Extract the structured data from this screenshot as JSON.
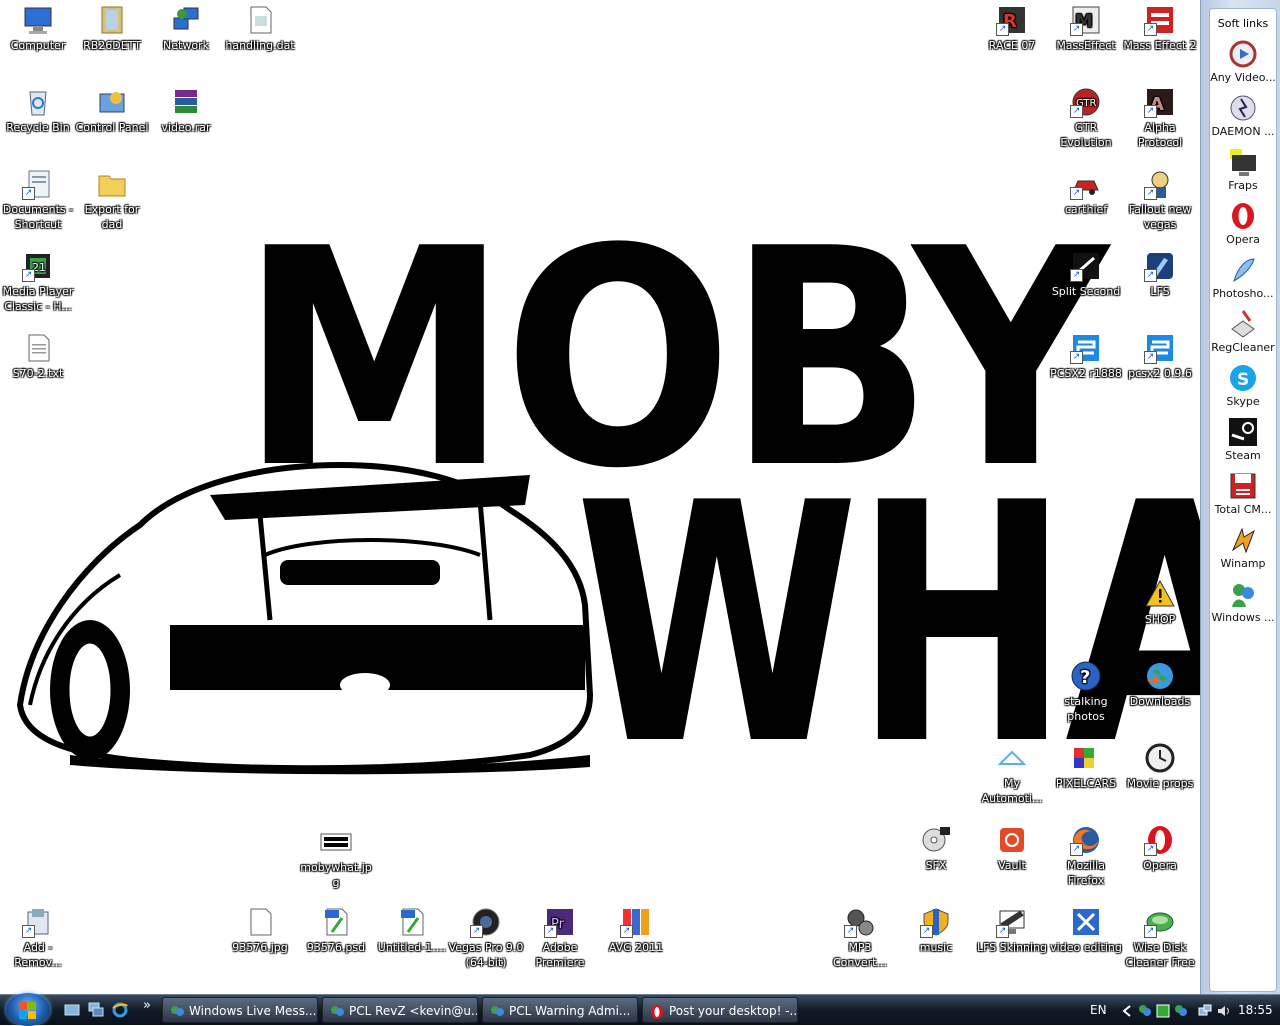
{
  "wallpaper": {
    "line1": "MOBY",
    "line2": "WHAT"
  },
  "desktop_icons": [
    {
      "label": "Computer",
      "icon": "computer-icon"
    },
    {
      "label": "RB26DETT",
      "icon": "folder-icon"
    },
    {
      "label": "Network",
      "icon": "network-icon"
    },
    {
      "label": "handling.dat",
      "icon": "file-icon"
    },
    {
      "label": "Recycle Bin",
      "icon": "recycle-bin-icon"
    },
    {
      "label": "Control Panel",
      "icon": "control-panel-icon"
    },
    {
      "label": "video.rar",
      "icon": "winrar-icon"
    },
    {
      "label": "Documents - Shortcut",
      "icon": "documents-shortcut-icon"
    },
    {
      "label": "Export for dad",
      "icon": "folder-icon"
    },
    {
      "label": "Media Player Classic - H...",
      "icon": "media-player-icon"
    },
    {
      "label": "S70-2.txt",
      "icon": "text-file-icon"
    },
    {
      "label": "RACE 07",
      "icon": "race07-icon"
    },
    {
      "label": "MassEffect",
      "icon": "masseffect-icon"
    },
    {
      "label": "Mass Effect 2",
      "icon": "masseffect2-icon"
    },
    {
      "label": "GTR Evolution",
      "icon": "gtr-evolution-icon"
    },
    {
      "label": "Alpha Protocol",
      "icon": "alpha-protocol-icon"
    },
    {
      "label": "carthief",
      "icon": "carthief-icon"
    },
    {
      "label": "Fallout new vegas",
      "icon": "fallout-icon"
    },
    {
      "label": "Split Second",
      "icon": "split-second-icon"
    },
    {
      "label": "LFS",
      "icon": "lfs-icon"
    },
    {
      "label": "PCSX2 r1888",
      "icon": "pcsx2-icon"
    },
    {
      "label": "pcsx2 0.9.6",
      "icon": "pcsx2-icon"
    },
    {
      "label": "SHOP",
      "icon": "warning-icon"
    },
    {
      "label": "stalking photos",
      "icon": "help-icon"
    },
    {
      "label": "Downloads",
      "icon": "globe-icon"
    },
    {
      "label": "My Automoti...",
      "icon": "triangle-icon"
    },
    {
      "label": "PIXELCARS",
      "icon": "pixelcars-icon"
    },
    {
      "label": "Movie props",
      "icon": "clock-icon"
    },
    {
      "label": "SFX",
      "icon": "sfx-icon"
    },
    {
      "label": "Vault",
      "icon": "vault-icon"
    },
    {
      "label": "Mozilla Firefox",
      "icon": "firefox-icon"
    },
    {
      "label": "Opera",
      "icon": "opera-icon"
    },
    {
      "label": "mobywhat.jpg",
      "icon": "image-icon"
    },
    {
      "label": "Add - Remov...",
      "icon": "add-remove-icon"
    },
    {
      "label": "93576.jpg",
      "icon": "file-icon"
    },
    {
      "label": "93576.psd",
      "icon": "psd-icon"
    },
    {
      "label": "Untitled-1....",
      "icon": "psd-icon"
    },
    {
      "label": "Vegas Pro 9.0 (64-bit)",
      "icon": "vegas-icon"
    },
    {
      "label": "Adobe Premiere",
      "icon": "premiere-icon"
    },
    {
      "label": "AVG 2011",
      "icon": "avg-icon"
    },
    {
      "label": "MP3 Convert...",
      "icon": "mp3-converter-icon"
    },
    {
      "label": "music",
      "icon": "shield-icon"
    },
    {
      "label": "LFS Skinning",
      "icon": "monitor-icon"
    },
    {
      "label": "video editing",
      "icon": "video-editing-icon"
    },
    {
      "label": "Wise Disk Cleaner Free",
      "icon": "wise-disk-icon"
    }
  ],
  "sidebar": {
    "title": "Soft links",
    "items": [
      {
        "label": "Any Video...",
        "icon": "any-video-icon"
      },
      {
        "label": "DAEMON ...",
        "icon": "daemon-icon"
      },
      {
        "label": "Fraps",
        "icon": "fraps-icon"
      },
      {
        "label": "Opera",
        "icon": "opera-icon"
      },
      {
        "label": "Photosho...",
        "icon": "photoshop-icon"
      },
      {
        "label": "RegCleaner",
        "icon": "regcleaner-icon"
      },
      {
        "label": "Skype",
        "icon": "skype-icon"
      },
      {
        "label": "Steam",
        "icon": "steam-icon"
      },
      {
        "label": "Total CM...",
        "icon": "total-commander-icon"
      },
      {
        "label": "Winamp",
        "icon": "winamp-icon"
      },
      {
        "label": "Windows ...",
        "icon": "windows-live-icon"
      }
    ]
  },
  "taskbar": {
    "show_more": "»",
    "tasks": [
      {
        "label": "Windows Live Mess...",
        "icon": "messenger-icon"
      },
      {
        "label": "PCL RevZ <kevin@u...",
        "icon": "messenger-icon"
      },
      {
        "label": "PCL Warning Admi...",
        "icon": "messenger-icon"
      },
      {
        "label": "Post your desktop! -...",
        "icon": "opera-icon"
      }
    ],
    "language": "EN",
    "clock": "18:55"
  },
  "colors": {
    "taskbar": "#101a26",
    "sidebar": "#c7d5ea",
    "wallpaper_ink": "#000000"
  }
}
